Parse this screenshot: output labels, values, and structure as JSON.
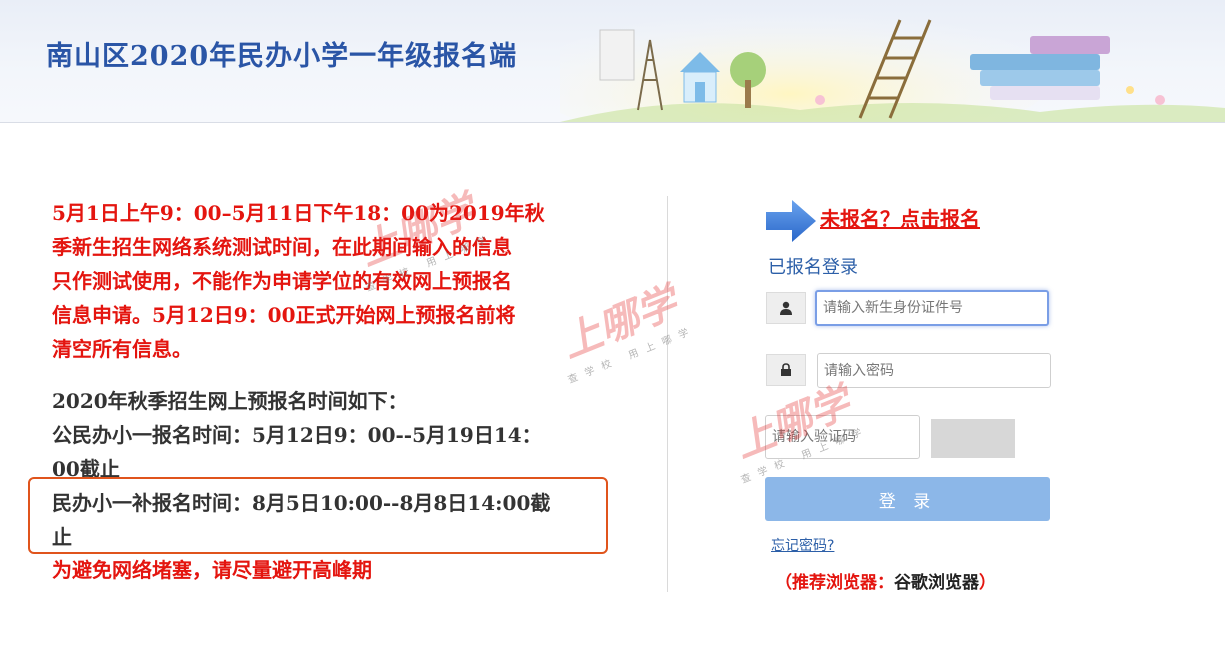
{
  "header": {
    "title": "南山区2020年民办小学一年级报名端"
  },
  "notice": {
    "red_lines": [
      "5月1日上午9：00–5月11日下午18：00为2019年秋",
      "季新生招生网络系统测试时间，在此期间输入的信息",
      "只作测试使用，不能作为申请学位的有效网上预报名",
      "信息申请。5月12日9：00正式开始网上预报名前将",
      "清空所有信息。"
    ]
  },
  "schedule": {
    "lines": [
      "2020年秋季招生网上预报名时间如下：",
      "公民办小一报名时间：5月12日9：00--5月19日14：",
      "00截止",
      "民办小一补报名时间：8月5日10:00--8月8日14:00截",
      "止"
    ],
    "advice": "为避免网络堵塞，请尽量避开高峰期"
  },
  "login": {
    "register_link": "未报名？点击报名",
    "heading": "已报名登录",
    "id_placeholder": "请输入新生身份证件号",
    "password_placeholder": "请输入密码",
    "captcha_placeholder": "请输入验证码",
    "login_button": "登 录",
    "forgot_password": "忘记密码?",
    "browser_prefix": "（推荐浏览器：",
    "browser_name": "谷歌浏览器",
    "browser_suffix": "）"
  },
  "watermark": {
    "brand": "上哪学",
    "slogan": "查学校 用上哪学"
  },
  "colors": {
    "notice_red": "#e4150f",
    "title_blue": "#2a55a6",
    "button_blue": "#8cb7e8",
    "box_orange": "#e0541c"
  }
}
